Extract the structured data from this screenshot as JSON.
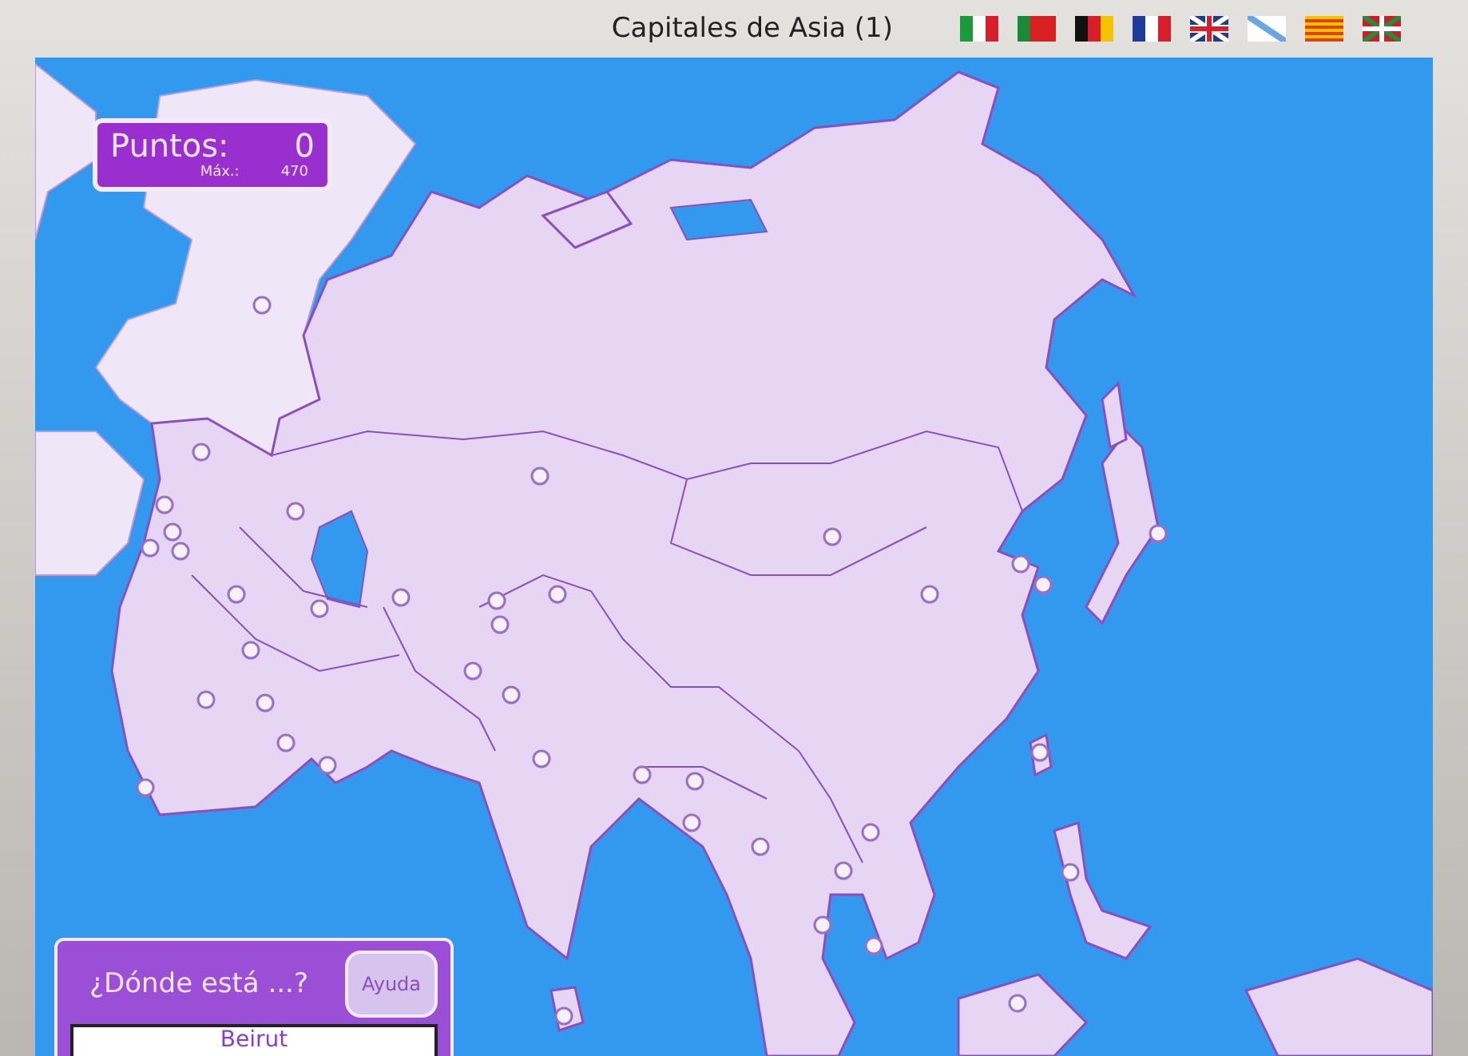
{
  "window": {
    "title": "Capitales de Asia (1)"
  },
  "score": {
    "label": "Puntos:",
    "value": "0",
    "max_label": "Máx.:",
    "max_value": "470"
  },
  "question": {
    "prompt": "¿Dónde está ...?",
    "help_button": "Ayuda",
    "answer": "Beirut"
  }
}
